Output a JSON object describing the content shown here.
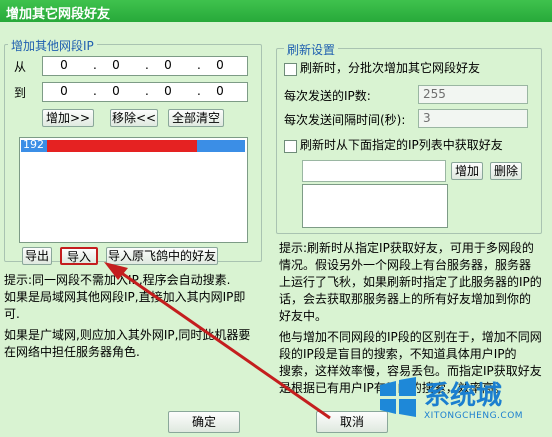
{
  "window": {
    "title": "增加其它网段好友"
  },
  "left_group": {
    "legend": "增加其他网段IP",
    "from_label": "从",
    "to_label": "到",
    "from_ip": [
      "0",
      "0",
      "0",
      "0"
    ],
    "to_ip": [
      "0",
      "0",
      "0",
      "0"
    ],
    "add_button": "增加>>",
    "remove_button": "移除<<",
    "clear_button": "全部清空",
    "list_item": "192",
    "export_button": "导出",
    "import_button": "导入",
    "import_feige_button": "导入原飞鸽中的好友",
    "tips": [
      "提示:同一网段不需加入IP,程序会自动搜素.",
      "如果是局域网其他网段IP,直接加入其内网IP即",
      "可.",
      "如果是广域网,则应加入其外网IP,同时此机器要",
      "在网络中担任服务器角色."
    ]
  },
  "right_group": {
    "legend": "刷新设置",
    "batch_checkbox": "刷新时，分批次增加其它网段好友",
    "ip_count_label": "每次发送的IP数:",
    "ip_count_value": "255",
    "interval_label": "每次发送间隔时间(秒):",
    "interval_value": "3",
    "specified_checkbox": "刷新时从下面指定的IP列表中获取好友",
    "add_button": "增加",
    "delete_button": "删除",
    "tips": [
      "提示:刷新时从指定IP获取好友，可用于多网段的",
      "情况。假设另外一个网段上有台服务器，服务器",
      "上运行了飞秋，如果刷新时指定了此服务器的IP的",
      "话，会去获取那服务器上的所有好友增加到你的",
      "好友中。",
      "他与增加不同网段的IP段的区别在于，增加不同网",
      "段的IP段是盲目的搜索，不知道具体用户IP的",
      "搜索，这样效率慢，容易丢包。而指定IP获取好友",
      "是根据已有用户IP有目的的搜索，效率高。"
    ]
  },
  "footer": {
    "ok_button": "确定",
    "cancel_button": "取消"
  },
  "watermark": {
    "brand": "系统城",
    "url": "XITONGCHENG.COM"
  },
  "colors": {
    "title_green": "#2fb645",
    "highlight_red": "#e52222",
    "selection_blue": "#3b8ee6"
  }
}
